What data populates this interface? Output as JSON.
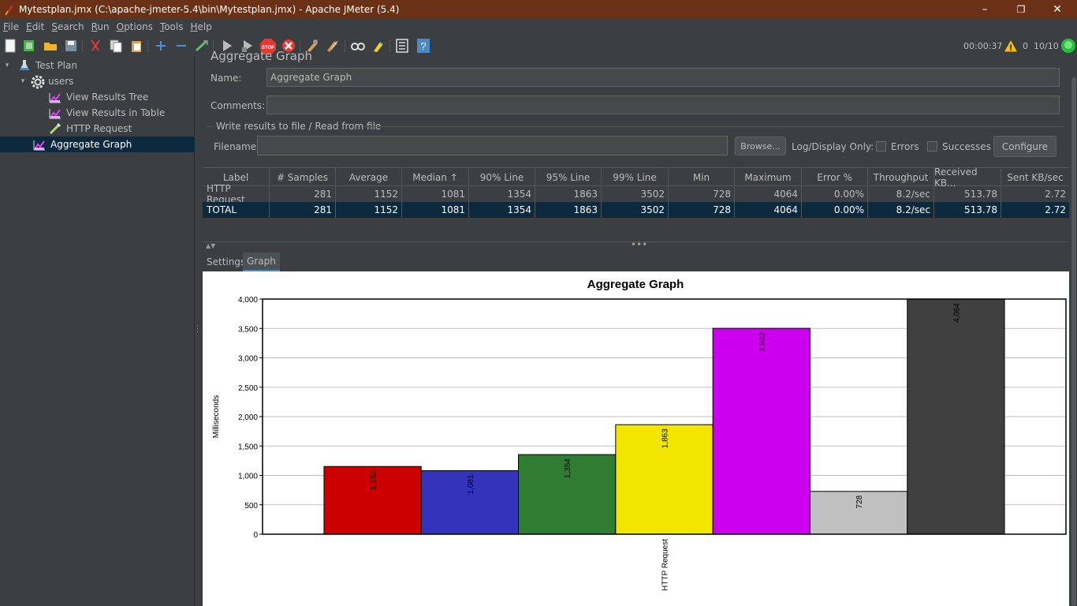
{
  "window": {
    "title": "Mytestplan.jmx (C:\\apache-jmeter-5.4\\bin\\Mytestplan.jmx) - Apache JMeter (5.4)",
    "minimize": "–",
    "maximize": "❐",
    "close": "✕"
  },
  "menu": {
    "items": [
      {
        "first": "F",
        "rest": "ile"
      },
      {
        "first": "E",
        "rest": "dit"
      },
      {
        "first": "S",
        "rest": "earch"
      },
      {
        "first": "R",
        "rest": "un"
      },
      {
        "first": "O",
        "rest": "ptions"
      },
      {
        "first": "T",
        "rest": "ools"
      },
      {
        "first": "H",
        "rest": "elp"
      }
    ]
  },
  "toolbar": {
    "timer": "00:00:37",
    "warning_count": "0",
    "threads": "10/10",
    "icons": [
      "new-icon",
      "templates-icon",
      "open-icon",
      "save-icon",
      "cut-icon",
      "copy-icon",
      "paste-icon",
      "expand-icon",
      "collapse-icon",
      "toggle-icon",
      "start-icon",
      "start-no-pause-icon",
      "stop-icon",
      "shutdown-icon",
      "clear-icon",
      "clear-all-icon",
      "search-icon",
      "reset-search-icon",
      "function-helper-icon",
      "help-icon"
    ]
  },
  "tree": {
    "items": [
      {
        "label": "Test Plan",
        "icon": "flask-icon",
        "level": 0,
        "toggle": "▾"
      },
      {
        "label": "users",
        "icon": "gear-icon",
        "level": 1,
        "toggle": "▾"
      },
      {
        "label": "View Results Tree",
        "icon": "graph-listener-icon",
        "level": 2,
        "toggle": ""
      },
      {
        "label": "View Results in Table",
        "icon": "graph-listener-icon",
        "level": 2,
        "toggle": ""
      },
      {
        "label": "HTTP Request",
        "icon": "pipette-icon",
        "level": 2,
        "toggle": ""
      },
      {
        "label": "Aggregate Graph",
        "icon": "graph-listener-icon",
        "level": 1,
        "toggle": ""
      }
    ]
  },
  "panel": {
    "title": "Aggregate Graph",
    "name_label": "Name:",
    "name_value": "Aggregate Graph",
    "comments_label": "Comments:",
    "comments_value": "",
    "file_section": "Write results to file / Read from file",
    "filename_label": "Filename",
    "filename_value": "",
    "browse": "Browse...",
    "log_display": "Log/Display Only:",
    "errors": "Errors",
    "successes": "Successes",
    "configure": "Configure"
  },
  "table": {
    "columns": [
      "Label",
      "# Samples",
      "Average",
      "Median ↑",
      "90% Line",
      "95% Line",
      "99% Line",
      "Min",
      "Maximum",
      "Error %",
      "Throughput",
      "Received KB...",
      "Sent KB/sec"
    ],
    "rows": [
      [
        "HTTP Request",
        "281",
        "1152",
        "1081",
        "1354",
        "1863",
        "3502",
        "728",
        "4064",
        "0.00%",
        "8.2/sec",
        "513.78",
        "2.72"
      ],
      [
        "TOTAL",
        "281",
        "1152",
        "1081",
        "1354",
        "1863",
        "3502",
        "728",
        "4064",
        "0.00%",
        "8.2/sec",
        "513.78",
        "2.72"
      ]
    ]
  },
  "tabs": [
    "Settings",
    "Graph"
  ],
  "chart_data": {
    "type": "bar",
    "title": "Aggregate Graph",
    "ylabel": "Milliseconds",
    "xlabel": "",
    "categories": [
      "HTTP Request"
    ],
    "ylim": [
      0,
      4000
    ],
    "yticks": [
      "0",
      "500",
      "1,000",
      "1,500",
      "2,000",
      "2,500",
      "3,000",
      "3,500",
      "4,000"
    ],
    "grid": true,
    "series": [
      {
        "values": [
          1152
        ],
        "label": "1,152",
        "color": "#cc0000"
      },
      {
        "values": [
          1081
        ],
        "label": "1,081",
        "color": "#3333bb"
      },
      {
        "values": [
          1354
        ],
        "label": "1,354",
        "color": "#2e7d32"
      },
      {
        "values": [
          1863
        ],
        "label": "1,863",
        "color": "#f2e600"
      },
      {
        "values": [
          3502
        ],
        "label": "3,502",
        "color": "#cc00ee"
      },
      {
        "values": [
          728
        ],
        "label": "728",
        "color": "#c0c0c0"
      },
      {
        "values": [
          4064
        ],
        "label": "4,064",
        "color": "#404040"
      }
    ]
  }
}
